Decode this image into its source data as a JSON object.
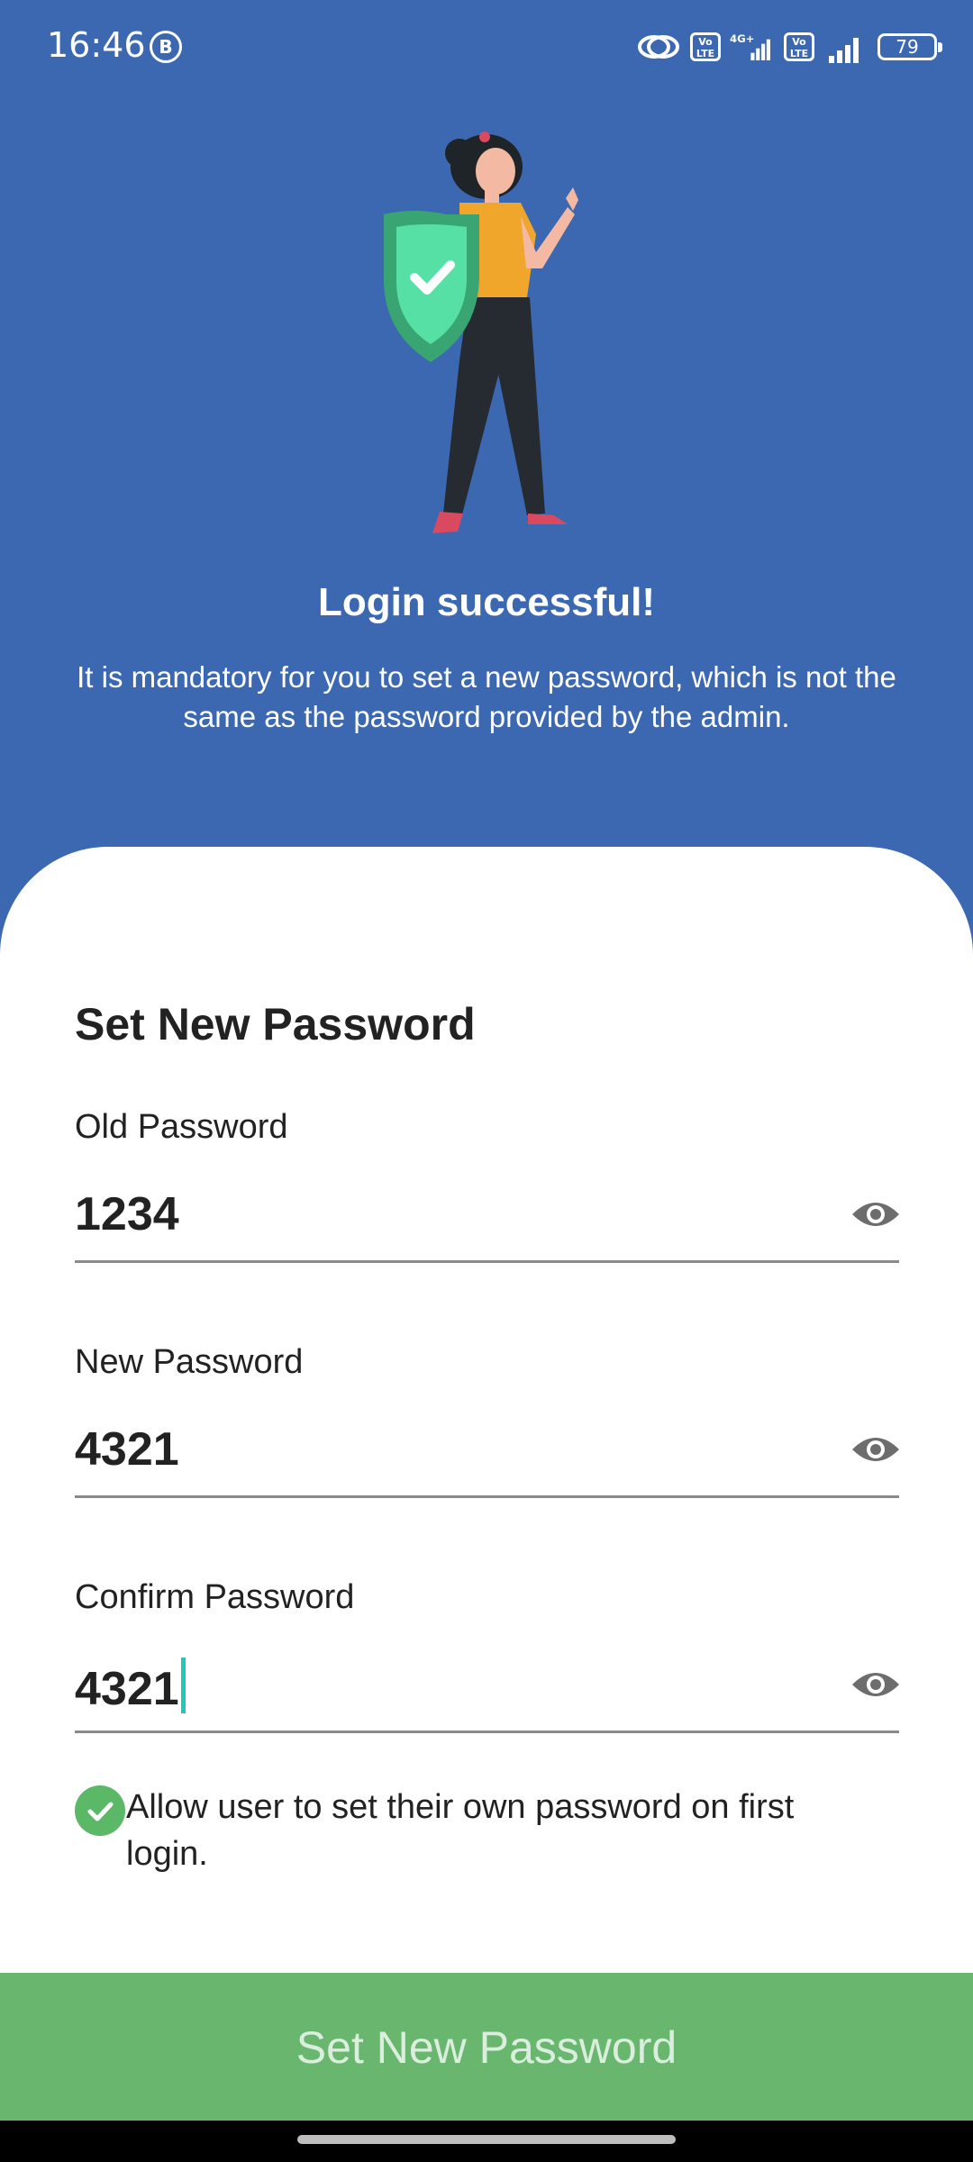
{
  "status_bar": {
    "time": "16:46",
    "b_badge": "B",
    "volte_1": "Vo LTE",
    "network": "4G+",
    "volte_2": "Vo LTE",
    "battery": "79"
  },
  "hero": {
    "title": "Login successful!",
    "message": "It is mandatory for you to set a new password, which is not the same as the password provided by the admin.",
    "background_color": "#3b68b1"
  },
  "form": {
    "title": "Set New Password",
    "old_password": {
      "label": "Old Password",
      "value": "1234"
    },
    "new_password": {
      "label": "New Password",
      "value": "4321"
    },
    "confirm_password": {
      "label": "Confirm Password",
      "value": "4321"
    },
    "allow_checkbox": {
      "label": "Allow user to set their own password on first login.",
      "checked": true
    }
  },
  "submit_button": {
    "label": "Set New Password",
    "color": "#69b76f"
  }
}
